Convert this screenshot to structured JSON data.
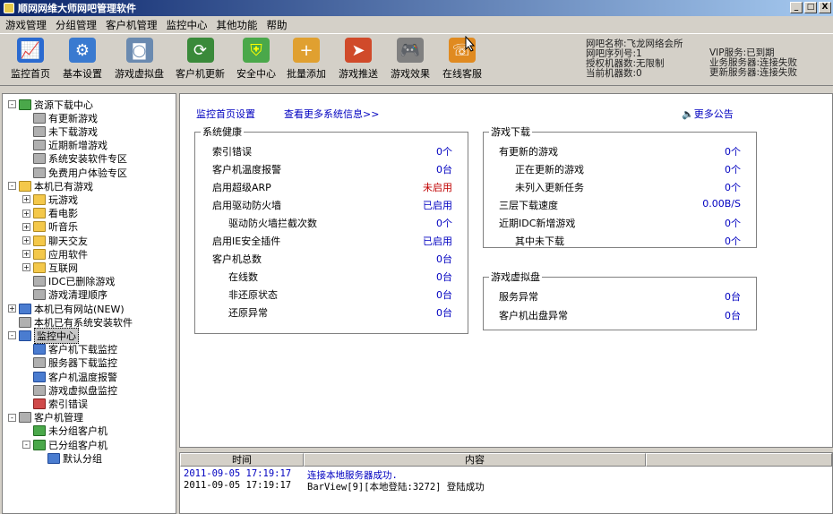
{
  "window": {
    "title": "顺网网维大师网吧管理软件",
    "min": "_",
    "max": "□",
    "close": "X"
  },
  "menu": [
    "游戏管理",
    "分组管理",
    "客户机管理",
    "监控中心",
    "其他功能",
    "帮助"
  ],
  "toolbar": [
    {
      "label": "监控首页",
      "icon": "monitor-chart-icon",
      "color": "#2a6ad0"
    },
    {
      "label": "基本设置",
      "icon": "gear-icon",
      "color": "#3a7ad0"
    },
    {
      "label": "游戏虚拟盘",
      "icon": "disk-icon",
      "color": "#6a8ab0"
    },
    {
      "label": "客户机更新",
      "icon": "refresh-icon",
      "color": "#3a8a3a"
    },
    {
      "label": "安全中心",
      "icon": "shield-icon",
      "color": "#4aa84a"
    },
    {
      "label": "批量添加",
      "icon": "add-folder-icon",
      "color": "#e0a030"
    },
    {
      "label": "游戏推送",
      "icon": "push-icon",
      "color": "#d04a2a"
    },
    {
      "label": "游戏效果",
      "icon": "gamepad-icon",
      "color": "#808080"
    },
    {
      "label": "在线客服",
      "icon": "chat-icon",
      "color": "#e08a20"
    }
  ],
  "info_left": [
    "网吧名称:飞龙网络会所",
    "网吧序列号:1",
    "授权机器数:无限制",
    "当前机器数:0"
  ],
  "info_right": [
    "VIP服务:已到期",
    "业务服务器:连接失败",
    "更新服务器:连接失败"
  ],
  "tree": [
    {
      "label": "资源下载中心",
      "level": 0,
      "box": "-",
      "icon": "green"
    },
    {
      "label": "有更新游戏",
      "level": 1,
      "icon": "gray"
    },
    {
      "label": "未下载游戏",
      "level": 1,
      "icon": "gray"
    },
    {
      "label": "近期新增游戏",
      "level": 1,
      "icon": "gray"
    },
    {
      "label": "系统安装软件专区",
      "level": 1,
      "icon": "gray"
    },
    {
      "label": "免费用户体验专区",
      "level": 1,
      "icon": "gray"
    },
    {
      "label": "本机已有游戏",
      "level": 0,
      "box": "-",
      "icon": "folder"
    },
    {
      "label": "玩游戏",
      "level": 1,
      "box": "+",
      "icon": "folder"
    },
    {
      "label": "看电影",
      "level": 1,
      "box": "+",
      "icon": "folder"
    },
    {
      "label": "听音乐",
      "level": 1,
      "box": "+",
      "icon": "folder"
    },
    {
      "label": "聊天交友",
      "level": 1,
      "box": "+",
      "icon": "folder"
    },
    {
      "label": "应用软件",
      "level": 1,
      "box": "+",
      "icon": "folder"
    },
    {
      "label": "互联网",
      "level": 1,
      "box": "+",
      "icon": "folder"
    },
    {
      "label": "IDC已删除游戏",
      "level": 1,
      "icon": "gray"
    },
    {
      "label": "游戏清理顺序",
      "level": 1,
      "icon": "gray"
    },
    {
      "label": "本机已有网站(NEW)",
      "level": 0,
      "box": "+",
      "icon": "blue"
    },
    {
      "label": "本机已有系统安装软件",
      "level": 0,
      "icon": "gray"
    },
    {
      "label": "监控中心",
      "level": 0,
      "box": "-",
      "icon": "blue",
      "selected": true
    },
    {
      "label": "客户机下载监控",
      "level": 1,
      "icon": "blue"
    },
    {
      "label": "服务器下载监控",
      "level": 1,
      "icon": "gray"
    },
    {
      "label": "客户机温度报警",
      "level": 1,
      "icon": "blue"
    },
    {
      "label": "游戏虚拟盘监控",
      "level": 1,
      "icon": "gray"
    },
    {
      "label": "索引错误",
      "level": 1,
      "icon": "red"
    },
    {
      "label": "客户机管理",
      "level": 0,
      "box": "-",
      "icon": "gray"
    },
    {
      "label": "未分组客户机",
      "level": 1,
      "icon": "green"
    },
    {
      "label": "已分组客户机",
      "level": 1,
      "box": "-",
      "icon": "green"
    },
    {
      "label": "默认分组",
      "level": 2,
      "icon": "blue"
    }
  ],
  "main": {
    "link_settings": "监控首页设置",
    "link_more_info": "查看更多系统信息>>",
    "link_announce": "更多公告",
    "health": {
      "title": "系统健康",
      "rows": [
        {
          "label": "索引错误",
          "value": "0个",
          "indent": false,
          "color": "blue"
        },
        {
          "label": "客户机温度报警",
          "value": "0台",
          "indent": false,
          "color": "blue"
        },
        {
          "label": "启用超级ARP",
          "value": "未启用",
          "indent": false,
          "color": "red"
        },
        {
          "label": "启用驱动防火墙",
          "value": "已启用",
          "indent": false,
          "color": "blue"
        },
        {
          "label": "驱动防火墙拦截次数",
          "value": "0个",
          "indent": true,
          "color": "blue"
        },
        {
          "label": "启用IE安全插件",
          "value": "已启用",
          "indent": false,
          "color": "blue"
        },
        {
          "label": "客户机总数",
          "value": "0台",
          "indent": false,
          "color": "blue"
        },
        {
          "label": "在线数",
          "value": "0台",
          "indent": true,
          "color": "blue"
        },
        {
          "label": "非还原状态",
          "value": "0台",
          "indent": true,
          "color": "blue"
        },
        {
          "label": "还原异常",
          "value": "0台",
          "indent": true,
          "color": "blue"
        }
      ]
    },
    "download": {
      "title": "游戏下载",
      "rows": [
        {
          "label": "有更新的游戏",
          "value": "0个",
          "indent": false
        },
        {
          "label": "正在更新的游戏",
          "value": "0个",
          "indent": true
        },
        {
          "label": "未列入更新任务",
          "value": "0个",
          "indent": true
        },
        {
          "label": "三层下载速度",
          "value": "0.00B/S",
          "indent": false
        },
        {
          "label": "近期IDC新增游戏",
          "value": "0个",
          "indent": false
        },
        {
          "label": "其中未下载",
          "value": "0个",
          "indent": true
        }
      ]
    },
    "vdisk": {
      "title": "游戏虚拟盘",
      "rows": [
        {
          "label": "服务异常",
          "value": "0台"
        },
        {
          "label": "客户机出盘异常",
          "value": "0台"
        }
      ]
    }
  },
  "log": {
    "col_time": "时间",
    "col_content": "内容",
    "rows": [
      {
        "time": "2011-09-05 17:19:17",
        "content": "连接本地服务器成功.",
        "color": "blue"
      },
      {
        "time": "2011-09-05 17:19:17",
        "content": "BarView[9][本地登陆:3272] 登陆成功",
        "color": "black"
      }
    ]
  }
}
